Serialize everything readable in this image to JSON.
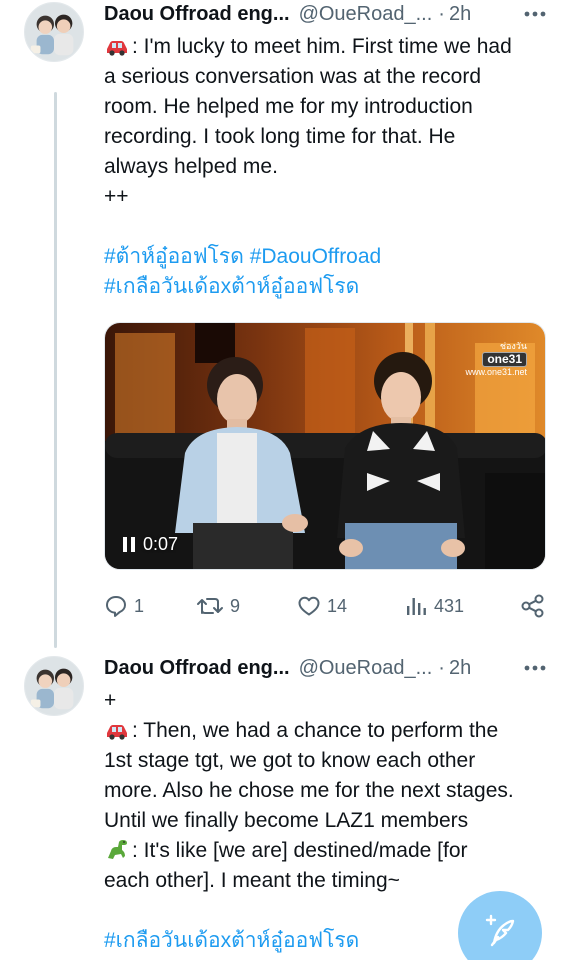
{
  "thread": {
    "tweets": [
      {
        "author": {
          "display_name": "Daou Offroad eng...",
          "handle": "@OueRoad_...",
          "dot": "·",
          "time": "2h"
        },
        "text_lines": [
          {
            "emoji": "car",
            "text": ": I'm lucky to meet him. First time we had"
          },
          {
            "text": "a serious conversation was at the record"
          },
          {
            "text": "room. He helped me for my introduction"
          },
          {
            "text": "recording. I took long time for that. He"
          },
          {
            "text": "always helped me."
          },
          {
            "text": "++"
          }
        ],
        "hashtags": [
          "#ต้าห์อู๋ออฟโรด #DaouOffroad",
          "#เกลือวันเด้อxต้าห์อู๋ออฟโรด"
        ],
        "media": {
          "type": "video",
          "time_label": "0:07",
          "channel": "one31",
          "channel_sub": "ช่องวัน",
          "channel_url": "www.one31.net"
        },
        "stats": {
          "replies": "1",
          "reposts": "9",
          "likes": "14",
          "views": "431"
        }
      },
      {
        "author": {
          "display_name": "Daou Offroad eng...",
          "handle": "@OueRoad_...",
          "dot": "·",
          "time": "2h"
        },
        "text_lines": [
          {
            "text": "+"
          },
          {
            "emoji": "car",
            "text": ": Then, we had a chance to perform the"
          },
          {
            "text": "1st stage tgt, we got to know each other"
          },
          {
            "text": "more. Also he chose me for the next stages."
          },
          {
            "text": "Until we finally become LAZ1 members"
          },
          {
            "emoji": "dinosaur",
            "text": ": It's like [we are] destined/made [for"
          },
          {
            "text": "each other]. I meant the timing~"
          }
        ],
        "hashtags": [
          "#เกลือวันเด้อxต้าห์อู๋ออฟโรด"
        ]
      }
    ]
  },
  "icons": {
    "reply": "reply-icon",
    "repost": "repost-icon",
    "like": "like-icon",
    "views": "views-icon",
    "share": "share-icon",
    "more": "more-icon",
    "compose": "compose-icon",
    "pause": "pause-icon"
  },
  "colors": {
    "link": "#1d9bf0",
    "muted": "#536471",
    "text": "#0f1419",
    "fab": "#8ecdf7",
    "thread_line": "#cfd9de"
  }
}
